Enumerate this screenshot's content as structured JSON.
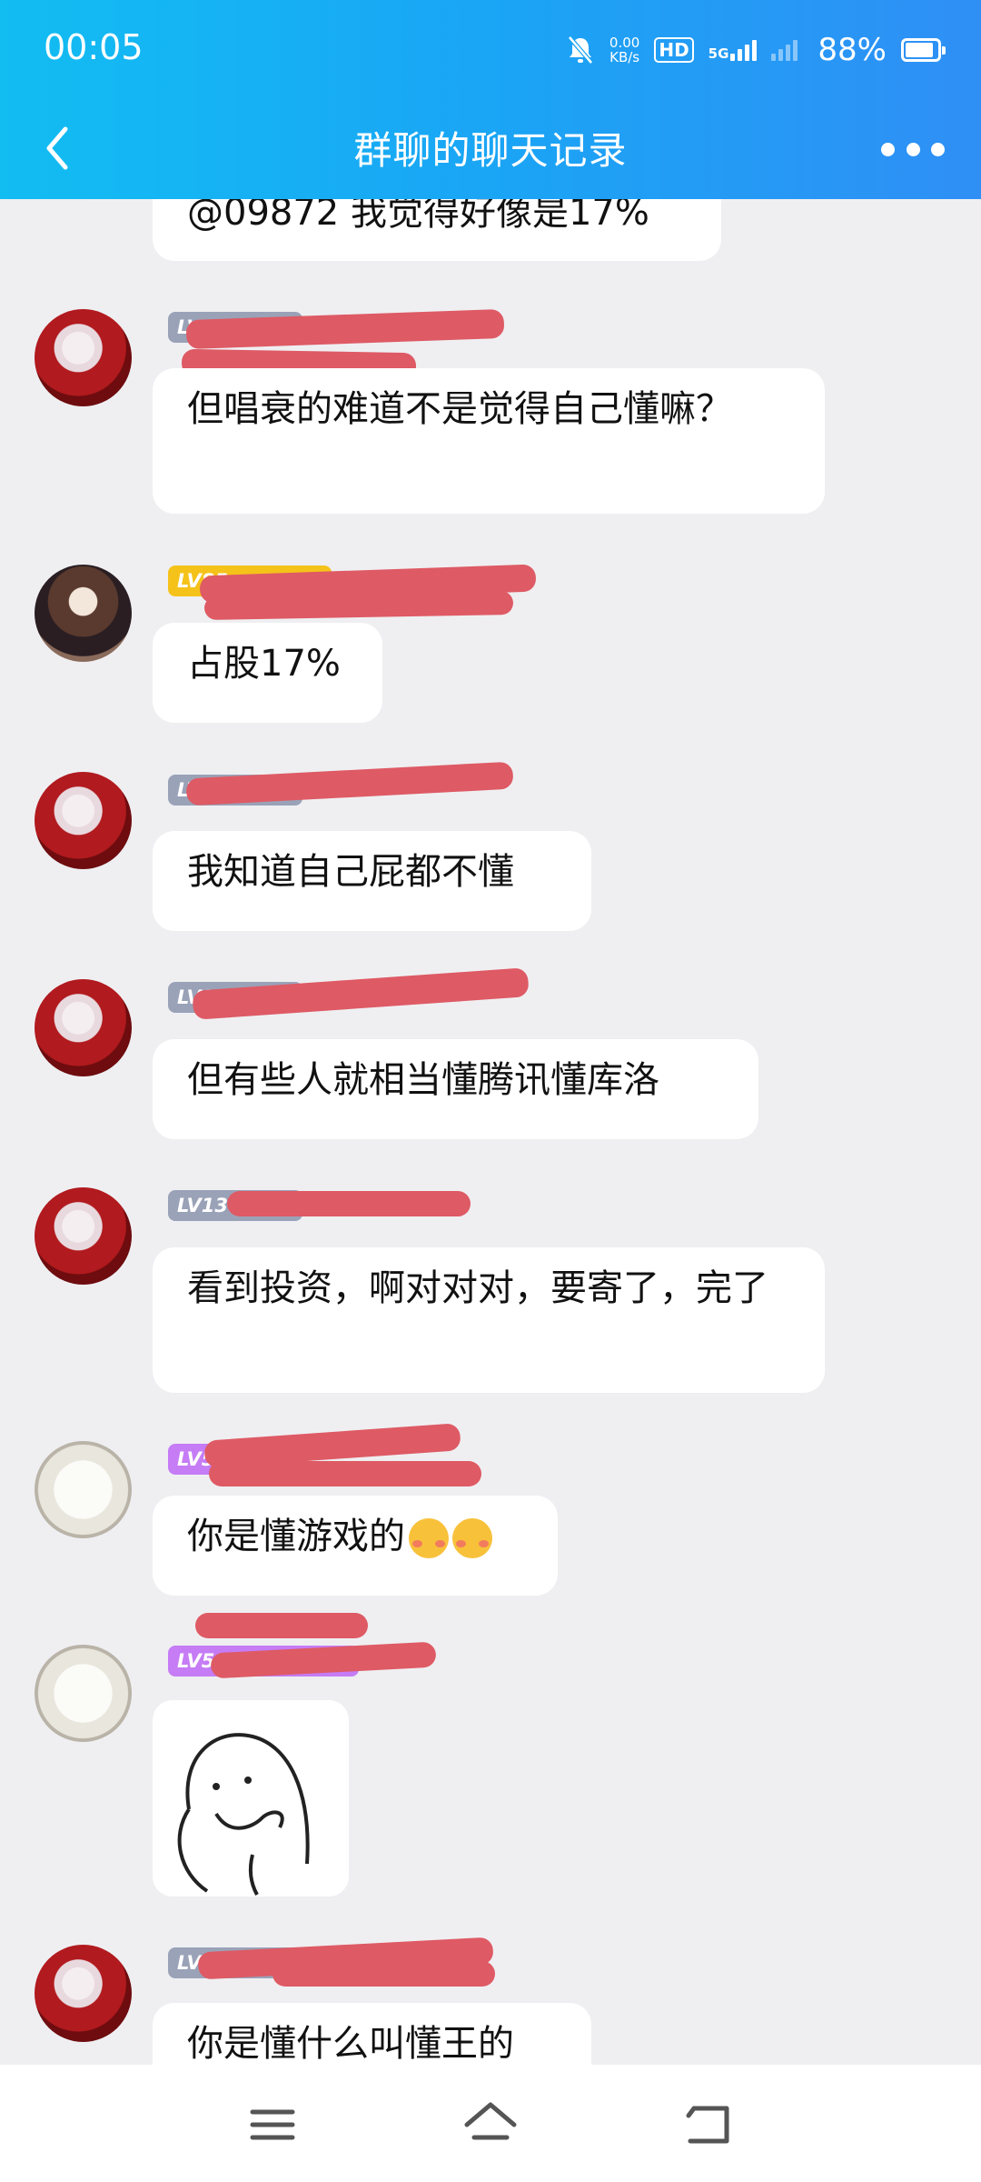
{
  "status_bar": {
    "time": "00:05",
    "net_speed_value": "0.00",
    "net_speed_unit": "KB/s",
    "hd_badge": "HD",
    "network": "5G",
    "battery": "88%",
    "battery_level": 0.88,
    "icons": [
      "mute-icon",
      "hd-icon",
      "5g-signal-icon",
      "signal-icon",
      "battery-icon"
    ]
  },
  "header": {
    "title": "群聊的聊天记录",
    "back_icon": "back-icon",
    "more_icon": "more-icon"
  },
  "colors": {
    "header_start": "#12bdf2",
    "header_end": "#2f8ff5",
    "chat_bg": "#efeff2",
    "bubble_bg": "#ffffff",
    "redaction": "#de5a64"
  },
  "messages": [
    {
      "text": "@09872 我觉得好像是17%"
    },
    {
      "level": "LV",
      "text": "但唱衰的难道不是觉得自己懂嘛？"
    },
    {
      "level": "LV85",
      "text": "占股17%"
    },
    {
      "level": "LV",
      "text": "我知道自己屁都不懂"
    },
    {
      "level": "LV1",
      "text": "但有些人就相当懂腾讯懂库洛"
    },
    {
      "level": "LV13",
      "text": "看到投资，啊对对对，要寄了，完了"
    },
    {
      "level": "LV5",
      "text": "你是懂游戏的",
      "emojis": [
        "blush-emoji",
        "blush-emoji"
      ]
    },
    {
      "level": "LV51",
      "sticker": "doodle-sticker"
    },
    {
      "level": "LV",
      "text": "你是懂什么叫懂王的"
    }
  ],
  "bottom_nav": [
    "menu-icon",
    "home-icon",
    "back-nav-icon"
  ]
}
